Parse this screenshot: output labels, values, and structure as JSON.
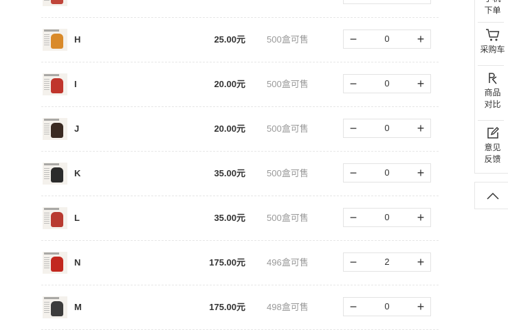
{
  "products": [
    {
      "name": "",
      "price": "",
      "stock": "",
      "qty": "",
      "fig_color": "#c0453a"
    },
    {
      "name": "H",
      "price": "25.00元",
      "stock": "500盒可售",
      "qty": "0",
      "fig_color": "#d98a2a"
    },
    {
      "name": "I",
      "price": "20.00元",
      "stock": "500盒可售",
      "qty": "0",
      "fig_color": "#c0352c"
    },
    {
      "name": "J",
      "price": "20.00元",
      "stock": "500盒可售",
      "qty": "0",
      "fig_color": "#3a2a22"
    },
    {
      "name": "K",
      "price": "35.00元",
      "stock": "500盒可售",
      "qty": "0",
      "fig_color": "#2b2b2b"
    },
    {
      "name": "L",
      "price": "35.00元",
      "stock": "500盒可售",
      "qty": "0",
      "fig_color": "#b83a30"
    },
    {
      "name": "N",
      "price": "175.00元",
      "stock": "496盒可售",
      "qty": "2",
      "fig_color": "#c2281f"
    },
    {
      "name": "M",
      "price": "175.00元",
      "stock": "498盒可售",
      "qty": "0",
      "fig_color": "#3c3c3c"
    }
  ],
  "stepper": {
    "minus": "−",
    "plus": "+"
  },
  "sidebar": {
    "mobile_order_line1": "手机",
    "mobile_order_line2": "下单",
    "cart": "采购车",
    "compare_line1": "商品",
    "compare_line2": "对比",
    "feedback_line1": "意见",
    "feedback_line2": "反馈"
  }
}
